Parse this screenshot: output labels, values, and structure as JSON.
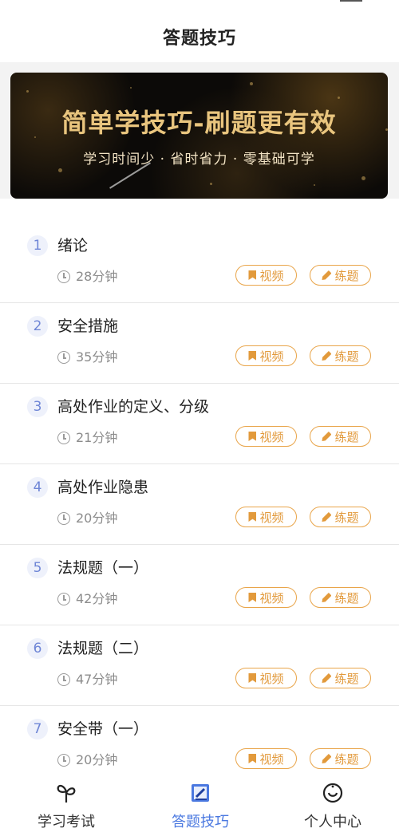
{
  "header": {
    "title": "答题技巧"
  },
  "banner": {
    "headline": "简单学技巧-刷题更有效",
    "subline": "学习时间少 · 省时省力 · 零基础可学"
  },
  "lessons": [
    {
      "num": "1",
      "name": "绪论",
      "duration": "28分钟",
      "video": "视频",
      "practice": "练题"
    },
    {
      "num": "2",
      "name": "安全措施",
      "duration": "35分钟",
      "video": "视频",
      "practice": "练题"
    },
    {
      "num": "3",
      "name": "高处作业的定义、分级",
      "duration": "21分钟",
      "video": "视频",
      "practice": "练题"
    },
    {
      "num": "4",
      "name": "高处作业隐患",
      "duration": "20分钟",
      "video": "视频",
      "practice": "练题"
    },
    {
      "num": "5",
      "name": "法规题（一）",
      "duration": "42分钟",
      "video": "视频",
      "practice": "练题"
    },
    {
      "num": "6",
      "name": "法规题（二）",
      "duration": "47分钟",
      "video": "视频",
      "practice": "练题"
    },
    {
      "num": "7",
      "name": "安全带（一）",
      "duration": "20分钟",
      "video": "视频",
      "practice": "练题"
    }
  ],
  "tabbar": {
    "tabs": [
      {
        "label": "学习考试",
        "icon": "sprout-icon"
      },
      {
        "label": "答题技巧",
        "icon": "edit-note-icon"
      },
      {
        "label": "个人中心",
        "icon": "smile-icon"
      }
    ],
    "active": 1,
    "accent": "#4a78e0"
  },
  "colors": {
    "pill": "#e29a3c",
    "badge_text": "#6f86d6"
  }
}
